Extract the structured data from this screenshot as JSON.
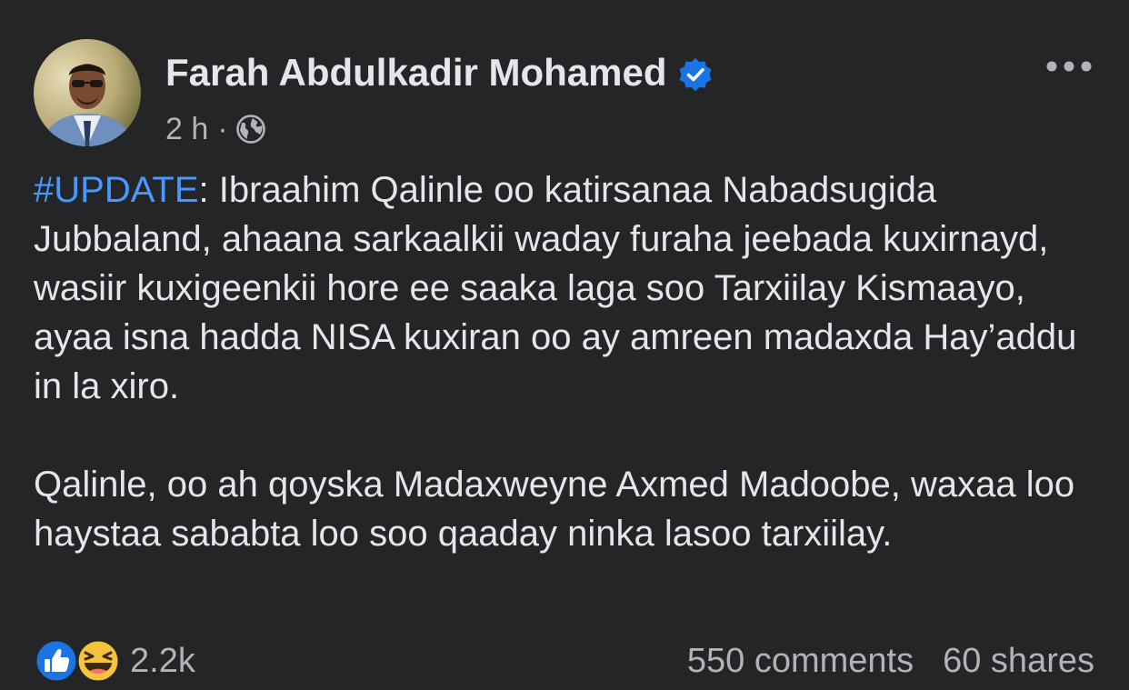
{
  "post": {
    "author": "Farah Abdulkadir Mohamed",
    "verified": true,
    "time": "2 h",
    "separator": "·",
    "audience_icon": "globe-icon",
    "more_icon": "more-horizontal-icon",
    "hashtag": "#UPDATE",
    "paragraph1_rest": ": Ibraahim Qalinle oo katirsanaa Nabadsugida Jubbaland, ahaana sarkaalkii waday furaha jeebada kuxirnayd, wasiir kuxigeenkii hore ee saaka laga soo Tarxiilay Kismaayo, ayaa isna hadda NISA kuxiran oo ay amreen madaxda Hay’addu in la xiro.",
    "paragraph2": "Qalinle, oo ah qoyska Madaxweyne Axmed Madoobe, waxaa loo haystaa sababta loo soo qaaday ninka lasoo tarxiilay."
  },
  "footer": {
    "reaction_icons": [
      "like-icon",
      "haha-icon"
    ],
    "reaction_count": "2.2k",
    "comments": "550 comments",
    "shares": "60 shares"
  },
  "colors": {
    "background": "#242526",
    "primary_text": "#e4e6eb",
    "secondary_text": "#b0b3b8",
    "link": "#4599ff",
    "verified_badge": "#1b74e4"
  }
}
